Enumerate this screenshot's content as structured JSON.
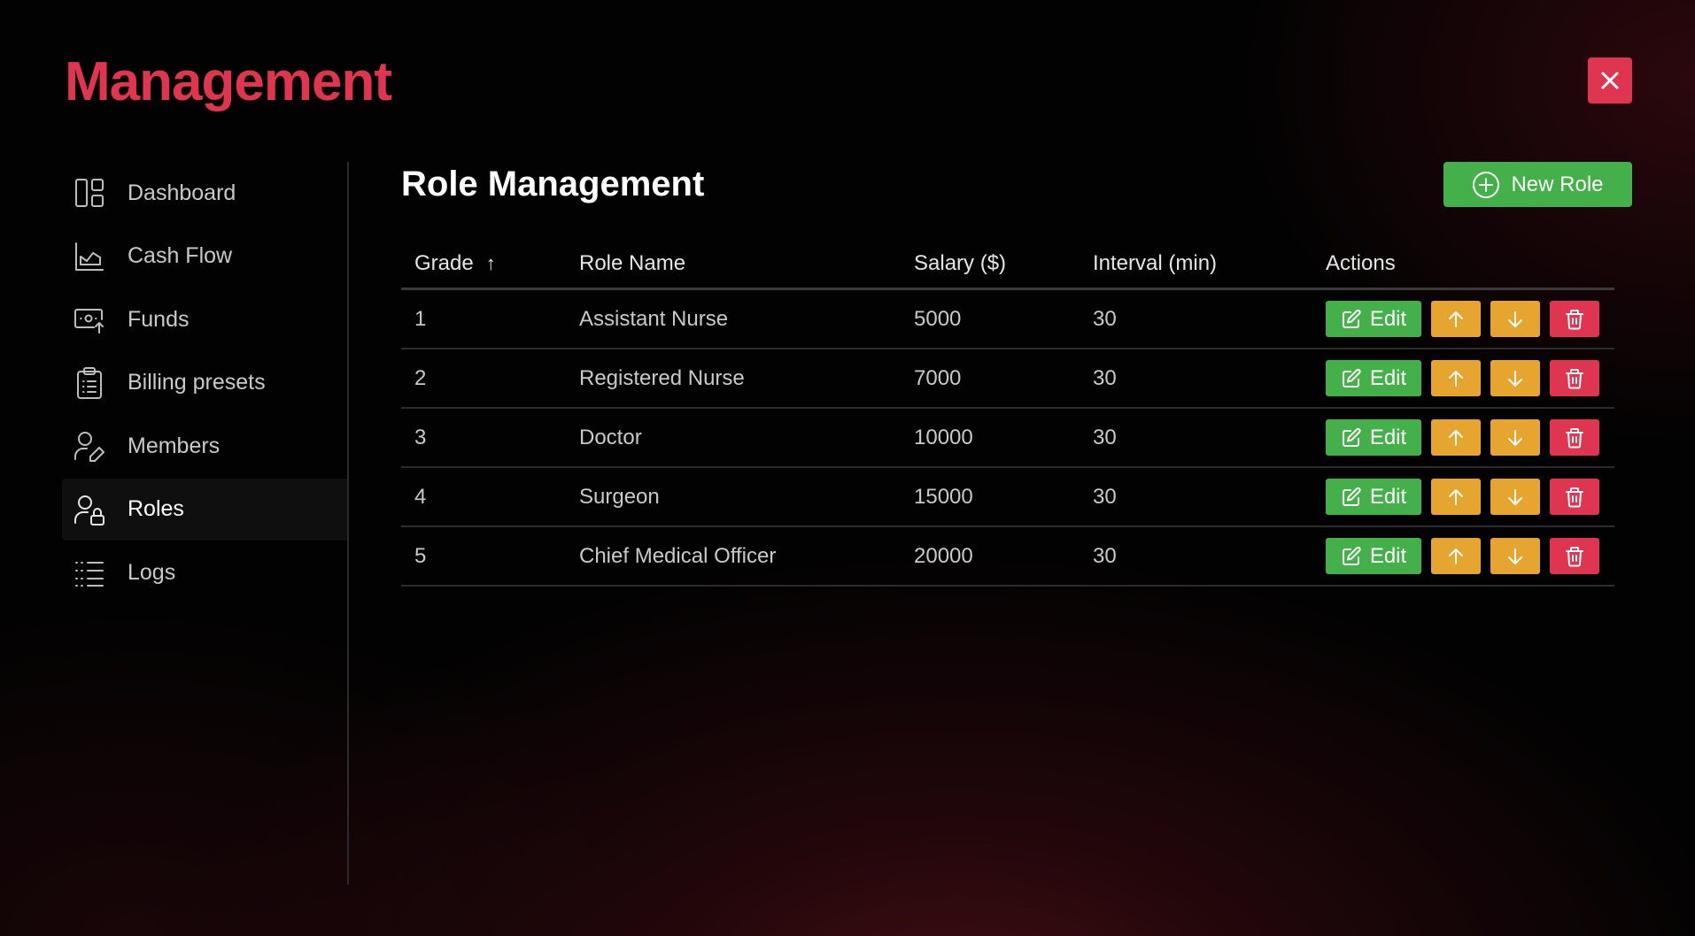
{
  "app": {
    "title": "Management",
    "close_label": "×"
  },
  "colors": {
    "accent_red": "#e03550",
    "success_green": "#44b04a",
    "warning_orange": "#e5a52e"
  },
  "sidebar": {
    "items": [
      {
        "label": "Dashboard",
        "icon": "dashboard-icon",
        "active": false
      },
      {
        "label": "Cash Flow",
        "icon": "chart-icon",
        "active": false
      },
      {
        "label": "Funds",
        "icon": "money-icon",
        "active": false
      },
      {
        "label": "Billing presets",
        "icon": "clipboard-icon",
        "active": false
      },
      {
        "label": "Members",
        "icon": "user-edit-icon",
        "active": false
      },
      {
        "label": "Roles",
        "icon": "user-lock-icon",
        "active": true
      },
      {
        "label": "Logs",
        "icon": "list-icon",
        "active": false
      }
    ]
  },
  "main": {
    "title": "Role Management",
    "new_role_label": "New Role",
    "table": {
      "columns": [
        "Grade",
        "Role Name",
        "Salary ($)",
        "Interval (min)",
        "Actions"
      ],
      "sort_indicator": "↑",
      "edit_label": "Edit",
      "rows": [
        {
          "grade": "1",
          "name": "Assistant Nurse",
          "salary": "5000",
          "interval": "30"
        },
        {
          "grade": "2",
          "name": "Registered Nurse",
          "salary": "7000",
          "interval": "30"
        },
        {
          "grade": "3",
          "name": "Doctor",
          "salary": "10000",
          "interval": "30"
        },
        {
          "grade": "4",
          "name": "Surgeon",
          "salary": "15000",
          "interval": "30"
        },
        {
          "grade": "5",
          "name": "Chief Medical Officer",
          "salary": "20000",
          "interval": "30"
        }
      ]
    }
  }
}
